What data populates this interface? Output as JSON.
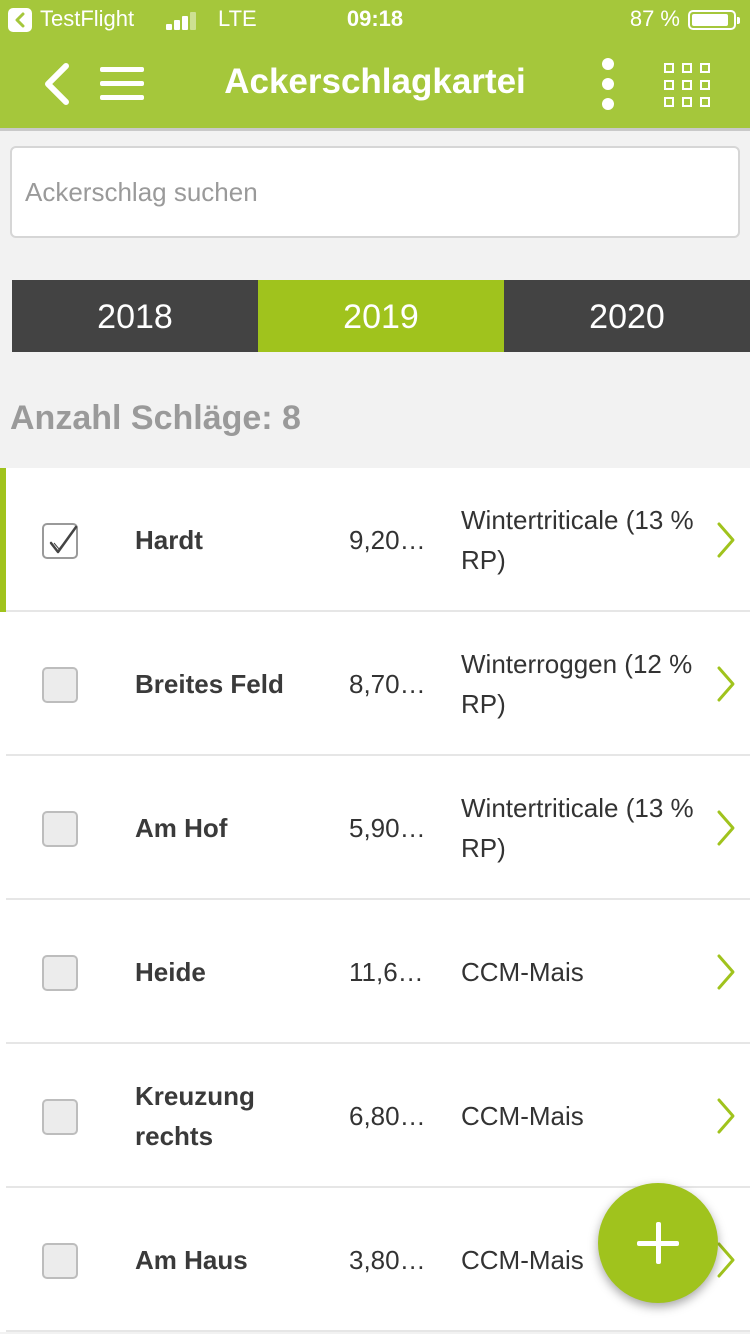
{
  "status_bar": {
    "carrier": "TestFlight",
    "network": "LTE",
    "time": "09:18",
    "battery": "87 %"
  },
  "header": {
    "title": "Ackerschlagkartei",
    "accent_color": "#a5c73b"
  },
  "search": {
    "placeholder": "Ackerschlag suchen",
    "value": ""
  },
  "years": {
    "tabs": [
      {
        "label": "2018"
      },
      {
        "label": "2019"
      },
      {
        "label": "2020"
      }
    ],
    "selected": "2019"
  },
  "summary": {
    "count_label": "Anzahl Schläge: 8"
  },
  "fields": [
    {
      "name": "Hardt",
      "area": "9,20…",
      "crop": "Wintertriticale (13 % RP)",
      "checked": true
    },
    {
      "name": "Breites Feld",
      "area": "8,70…",
      "crop": "Winterroggen (12 % RP)",
      "checked": false
    },
    {
      "name": "Am Hof",
      "area": "5,90…",
      "crop": "Wintertriticale (13 % RP)",
      "checked": false
    },
    {
      "name": "Heide",
      "area": "11,6…",
      "crop": "CCM-Mais",
      "checked": false
    },
    {
      "name": "Kreuzung rechts",
      "area": "6,80…",
      "crop": "CCM-Mais",
      "checked": false
    },
    {
      "name": "Am Haus",
      "area": "3,80…",
      "crop": "CCM-Mais",
      "checked": false
    }
  ],
  "icons": {
    "back": "chevron-left-icon",
    "menu": "hamburger-menu-icon",
    "more": "vertical-dots-icon",
    "grid": "grid-icon",
    "row_chevron": "chevron-right-icon",
    "add": "plus-icon"
  }
}
